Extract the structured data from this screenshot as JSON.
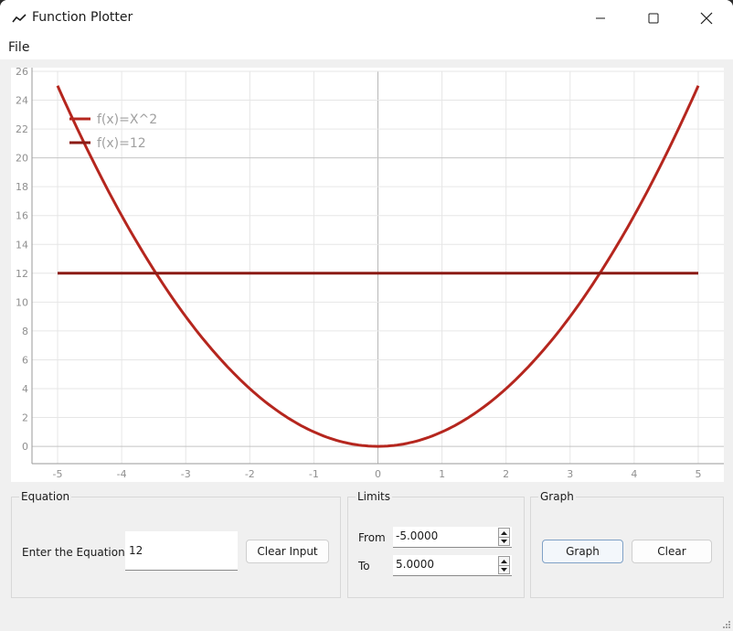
{
  "window": {
    "title": "Function Plotter",
    "icon": "line-chart-icon",
    "controls": {
      "minimize": "minimize-icon",
      "maximize": "maximize-icon",
      "close": "close-icon"
    }
  },
  "menu": {
    "items": [
      {
        "label": "File"
      }
    ]
  },
  "chart_data": {
    "type": "line",
    "title": "",
    "xlabel": "",
    "ylabel": "",
    "xlim": [
      -5.4,
      5.4
    ],
    "ylim": [
      -1.2,
      26
    ],
    "grid": true,
    "legend_position": "top-left",
    "x_ticks": [
      "-5",
      "-4",
      "-3",
      "-2",
      "-1",
      "0",
      "1",
      "2",
      "3",
      "4",
      "5"
    ],
    "y_ticks": [
      "0",
      "2",
      "4",
      "6",
      "8",
      "10",
      "12",
      "14",
      "16",
      "18",
      "20",
      "22",
      "24",
      "26"
    ],
    "series": [
      {
        "name": "f(x)=X^2",
        "expression": "x^2",
        "color": "#b5261e",
        "x_range": [
          -5,
          5
        ]
      },
      {
        "name": "f(x)=12",
        "expression": "12",
        "color": "#8b1a14",
        "x_range": [
          -5,
          5
        ]
      }
    ]
  },
  "equation_group": {
    "title": "Equation",
    "label": "Enter the Equation",
    "input_value": "12",
    "clear_button": "Clear Input"
  },
  "limits_group": {
    "title": "Limits",
    "from_label": "From",
    "from_value": "-5.0000",
    "to_label": "To",
    "to_value": "5.0000"
  },
  "graph_group": {
    "title": "Graph",
    "graph_button": "Graph",
    "clear_button": "Clear"
  }
}
